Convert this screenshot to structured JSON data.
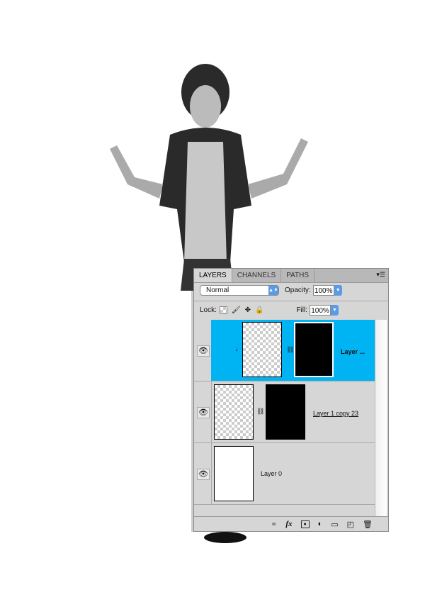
{
  "panel": {
    "tabs": [
      {
        "label": "LAYERS",
        "active": true
      },
      {
        "label": "CHANNELS",
        "active": false
      },
      {
        "label": "PATHS",
        "active": false
      }
    ],
    "blend_mode": "Normal",
    "opacity_label": "Opacity:",
    "opacity": "100%",
    "lock_label": "Lock:",
    "fill_label": "Fill:",
    "fill": "100%",
    "layers": [
      {
        "name": "Layer ...",
        "selected": true,
        "visible": true,
        "clipped": true,
        "has_mask": true
      },
      {
        "name": "Layer 1 copy 23",
        "selected": false,
        "visible": true,
        "has_mask": true
      },
      {
        "name": "Layer 0",
        "selected": false,
        "visible": true,
        "has_mask": false
      }
    ],
    "selected_color": "#00b4f4",
    "bottom_icons": [
      "link-icon",
      "fx-icon",
      "mask-icon",
      "adjustment-icon",
      "folder-icon",
      "new-layer-icon",
      "trash-icon"
    ]
  }
}
